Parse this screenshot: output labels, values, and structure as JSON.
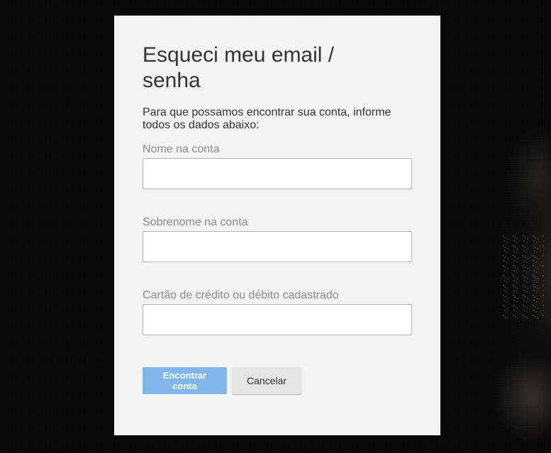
{
  "dialog": {
    "title": "Esqueci meu email / senha",
    "intro": "Para que possamos encontrar sua conta, informe todos os dados abaixo:",
    "fields": [
      {
        "label": "Nome na conta",
        "value": "",
        "placeholder": ""
      },
      {
        "label": "Sobrenome na conta",
        "value": "",
        "placeholder": ""
      },
      {
        "label": "Cartão de crédito ou débito cadastrado",
        "value": "",
        "placeholder": ""
      }
    ],
    "buttons": {
      "primary": "Encontrar conta",
      "secondary": "Cancelar"
    }
  },
  "colors": {
    "background": "#070707",
    "card": "#f3f3f3",
    "primary_button": "#7fb7ec",
    "secondary_button": "#e6e6e6",
    "label_text": "#8c8c8c",
    "body_text": "#333333"
  }
}
